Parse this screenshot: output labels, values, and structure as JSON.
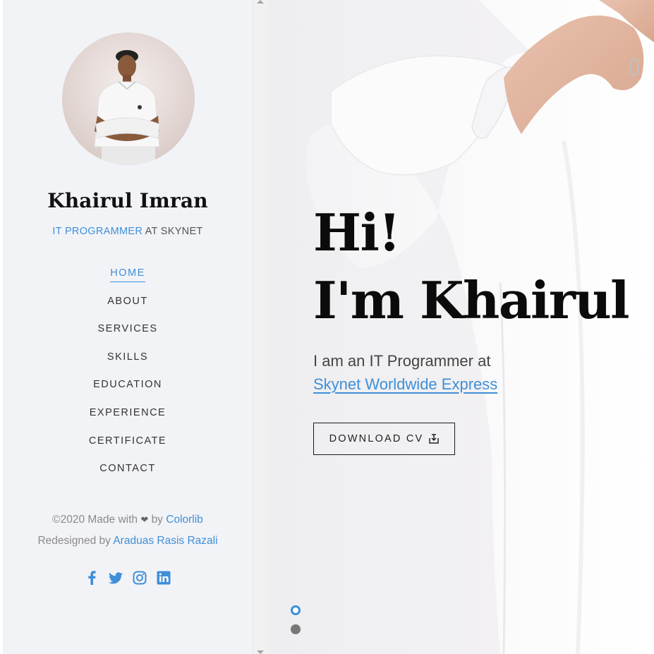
{
  "sidebar": {
    "name": "Khairul Imran",
    "role_highlight": "IT PROGRAMMER",
    "role_rest": " AT SKYNET",
    "nav": [
      {
        "label": "HOME",
        "active": true
      },
      {
        "label": "ABOUT"
      },
      {
        "label": "SERVICES"
      },
      {
        "label": "SKILLS"
      },
      {
        "label": "EDUCATION"
      },
      {
        "label": "EXPERIENCE"
      },
      {
        "label": "CERTIFICATE"
      },
      {
        "label": "CONTACT"
      }
    ],
    "footer": {
      "made_prefix": "©2020 Made with",
      "heart": "❤",
      "by_text": "by",
      "colorlib": "Colorlib",
      "redesigned_prefix": "Redesigned by",
      "redesigner": "Araduas Rasis Razali"
    },
    "social_icons": [
      "facebook-icon",
      "twitter-icon",
      "instagram-icon",
      "linkedin-icon"
    ]
  },
  "hero": {
    "title_line1": "Hi!",
    "title_line2": "I'm Khairul",
    "desc_line1": "I am an IT Programmer at",
    "desc_link": "Skynet Worldwide Express",
    "download_label": "DOWNLOAD CV",
    "download_icon": "download-icon",
    "slides": 2,
    "active_slide": 1
  },
  "colors": {
    "accent": "#3e8fd8",
    "sidebar_bg": "#f2f3f7",
    "text_dark": "#111111"
  }
}
